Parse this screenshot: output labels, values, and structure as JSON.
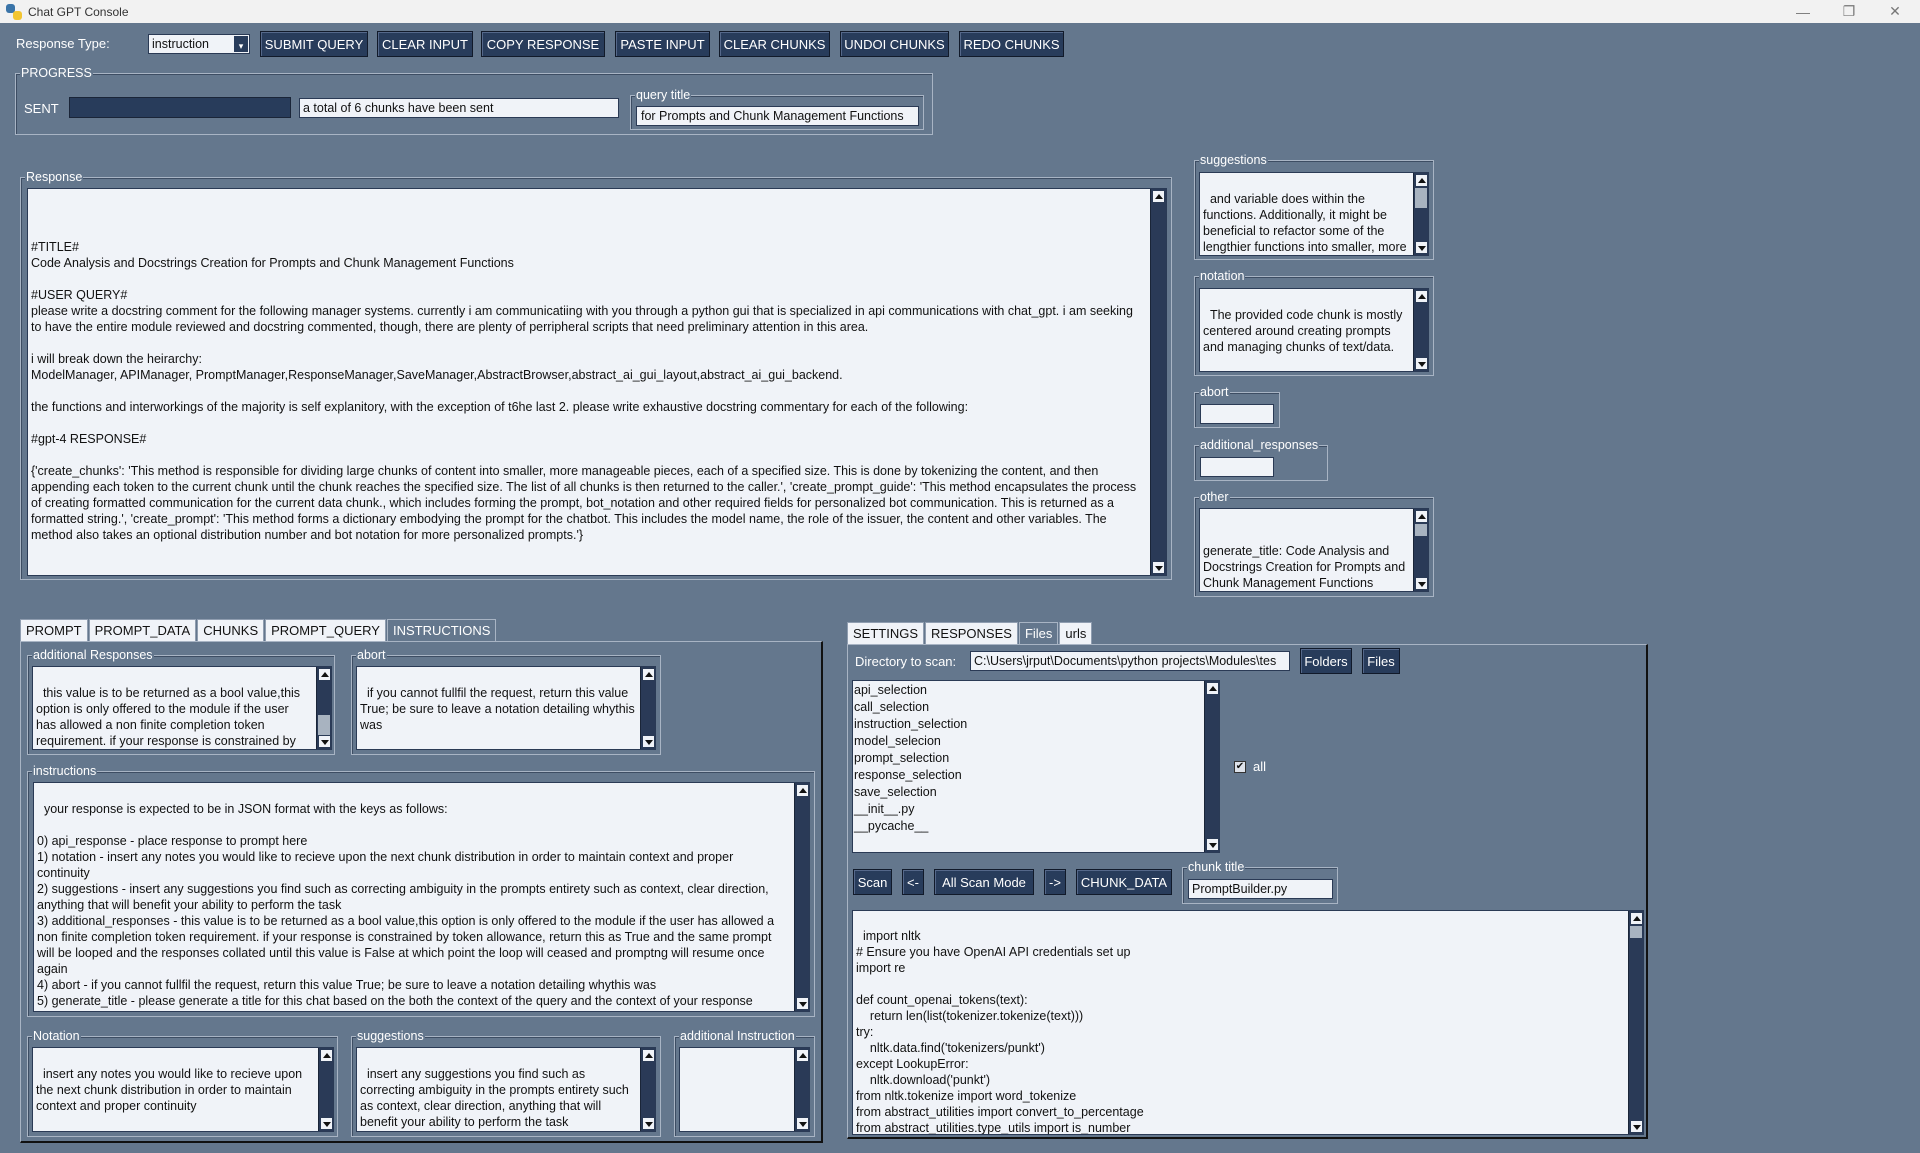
{
  "window": {
    "title": "Chat GPT Console",
    "controls": {
      "minimize": "—",
      "maximize": "❐",
      "close": "✕"
    }
  },
  "toolbar": {
    "response_type_label": "Response Type:",
    "response_type_value": "instruction",
    "buttons": [
      "SUBMIT QUERY",
      "CLEAR INPUT",
      "COPY RESPONSE",
      "PASTE INPUT",
      "CLEAR CHUNKS",
      "UNDOI CHUNKS",
      "REDO CHUNKS"
    ]
  },
  "progress": {
    "frame_label": "PROGRESS",
    "sent_label": "SENT",
    "sent_progress_percent": 100,
    "status_text": "a total of 6 chunks have been sent",
    "query_title_label": "query title",
    "query_title_value": "for Prompts and Chunk Management Functions"
  },
  "response": {
    "frame_label": "Response",
    "text": "\n\n#TITLE#\nCode Analysis and Docstrings Creation for Prompts and Chunk Management Functions\n\n#USER QUERY#\nplease write a docstring comment for the following manager systems. currently i am communicatiing with you through a python gui that is specialized in api communications with chat_gpt. i am seeking to have the entire module reviewed and docstring commented, though, there are plenty of perripheral scripts that need preliminary attention in this area.\n\ni will break down the heirarchy:\nModelManager, APIManager, PromptManager,ResponseManager,SaveManager,AbstractBrowser,abstract_ai_gui_layout,abstract_ai_gui_backend.\n\nthe functions and interworkings of the majority is self explanitory, with the exception of t6he last 2. please write exhaustive docstring commentary for each of the following:\n\n#gpt-4 RESPONSE#\n\n{'create_chunks': 'This method is responsible for dividing large chunks of content into smaller, more manageable pieces, each of a specified size. This is done by tokenizing the content, and then appending each token to the current chunk until the chunk reaches the specified size. The list of all chunks is then returned to the caller.', 'create_prompt_guide': 'This method encapsulates the process of creating formatted communication for the current data chunk., which includes forming the prompt, bot_notation and other required fields for personalized bot communication. This is returned as a formatted string.', 'create_prompt': 'This method forms a dictionary embodying the prompt for the chatbot. This includes the model name, the role of the issuer, the content and other variables. The method also takes an optional distribution number and bot notation for more personalized prompts.'}"
  },
  "side": {
    "suggestions": {
      "label": "suggestions",
      "text": "and variable does within the functions. Additionally, it might be beneficial to refactor some of the lengthier functions into smaller, more manageable functions."
    },
    "notation": {
      "label": "notation",
      "text": "The provided code chunk is mostly centered around creating prompts and managing chunks of text/data."
    },
    "abort": {
      "label": "abort",
      "value": ""
    },
    "additional_responses": {
      "label": "additional_responses",
      "value": ""
    },
    "other": {
      "label": "other",
      "text": "\ngenerate_title: Code Analysis and Docstrings Creation for Prompts and Chunk Management Functions"
    }
  },
  "left_tabs": {
    "tabs": [
      "PROMPT",
      "PROMPT_DATA",
      "CHUNKS",
      "PROMPT_QUERY",
      "INSTRUCTIONS"
    ],
    "active": "INSTRUCTIONS",
    "additional_responses": {
      "label": "additional Responses",
      "text": "this value is to be returned as a bool value,this option is only offered to the module if the user has allowed a non finite completion token requirement. if your response is constrained by token allowance, return this as True and the"
    },
    "abort": {
      "label": "abort",
      "text": "if you cannot fullfil the request, return this value True; be sure to leave a notation detailing whythis was"
    },
    "instructions": {
      "label": "instructions",
      "text": "your response is expected to be in JSON format with the keys as follows:\n\n0) api_response - place response to prompt here\n1) notation - insert any notes you would like to recieve upon the next chunk distribution in order to maintain context and proper continuity\n2) suggestions - insert any suggestions you find such as correcting ambiguity in the prompts entirety such as context, clear direction, anything that will benefit your ability to perform the task\n3) additional_responses - this value is to be returned as a bool value,this option is only offered to the module if the user has allowed a non finite completion token requirement. if your response is constrained by token allowance, return this as True and the same prompt will be looped and the responses collated until this value is False at which point the loop will ceased and promptng will resume once again\n4) abort - if you cannot fullfil the request, return this value True; be sure to leave a notation detailing whythis was\n5) generate_title - please generate a title for this chat based on the both the context of the query and the context of your response"
    },
    "notation": {
      "label": "Notation",
      "text": "insert any notes you would like to recieve upon the next chunk distribution in order to maintain context and proper continuity"
    },
    "suggestions": {
      "label": "suggestions",
      "text": "insert any suggestions you find such as correcting ambiguity in the prompts entirety such as context, clear direction, anything that will benefit your ability to perform the task"
    },
    "additional_instruction": {
      "label": "additional Instruction",
      "text": ""
    }
  },
  "right_tabs": {
    "tabs": [
      "SETTINGS",
      "RESPONSES",
      "Files",
      "urls"
    ],
    "active": "Files",
    "directory_label": "Directory to scan:",
    "directory_value": "C:\\Users\\jrput\\Documents\\python projects\\Modules\\tes",
    "folders_button": "Folders",
    "files_button": "Files",
    "file_list": [
      "api_selection",
      "call_selection",
      "instruction_selection",
      "model_selecion",
      "prompt_selection",
      "response_selection",
      "save_selection",
      "__init__.py",
      "__pycache__"
    ],
    "all_checkbox_label": "all",
    "all_checked": true,
    "scan_button": "Scan",
    "prev_button": "<-",
    "scan_mode_button": "All  Scan Mode",
    "next_button": "->",
    "chunk_data_button": "CHUNK_DATA",
    "chunk_title_label": "chunk title",
    "chunk_title_value": "PromptBuilder.py",
    "code_text": "import nltk\n# Ensure you have OpenAI API credentials set up\nimport re\n\ndef count_openai_tokens(text):\n    return len(list(tokenizer.tokenize(text)))\ntry:\n    nltk.data.find('tokenizers/punkt')\nexcept LookupError:\n    nltk.download('punkt')\nfrom nltk.tokenize import word_tokenize\nfrom abstract_utilities import convert_to_percentage\nfrom abstract_utilities.type_utils import is_number\nimport tiktoken"
  }
}
